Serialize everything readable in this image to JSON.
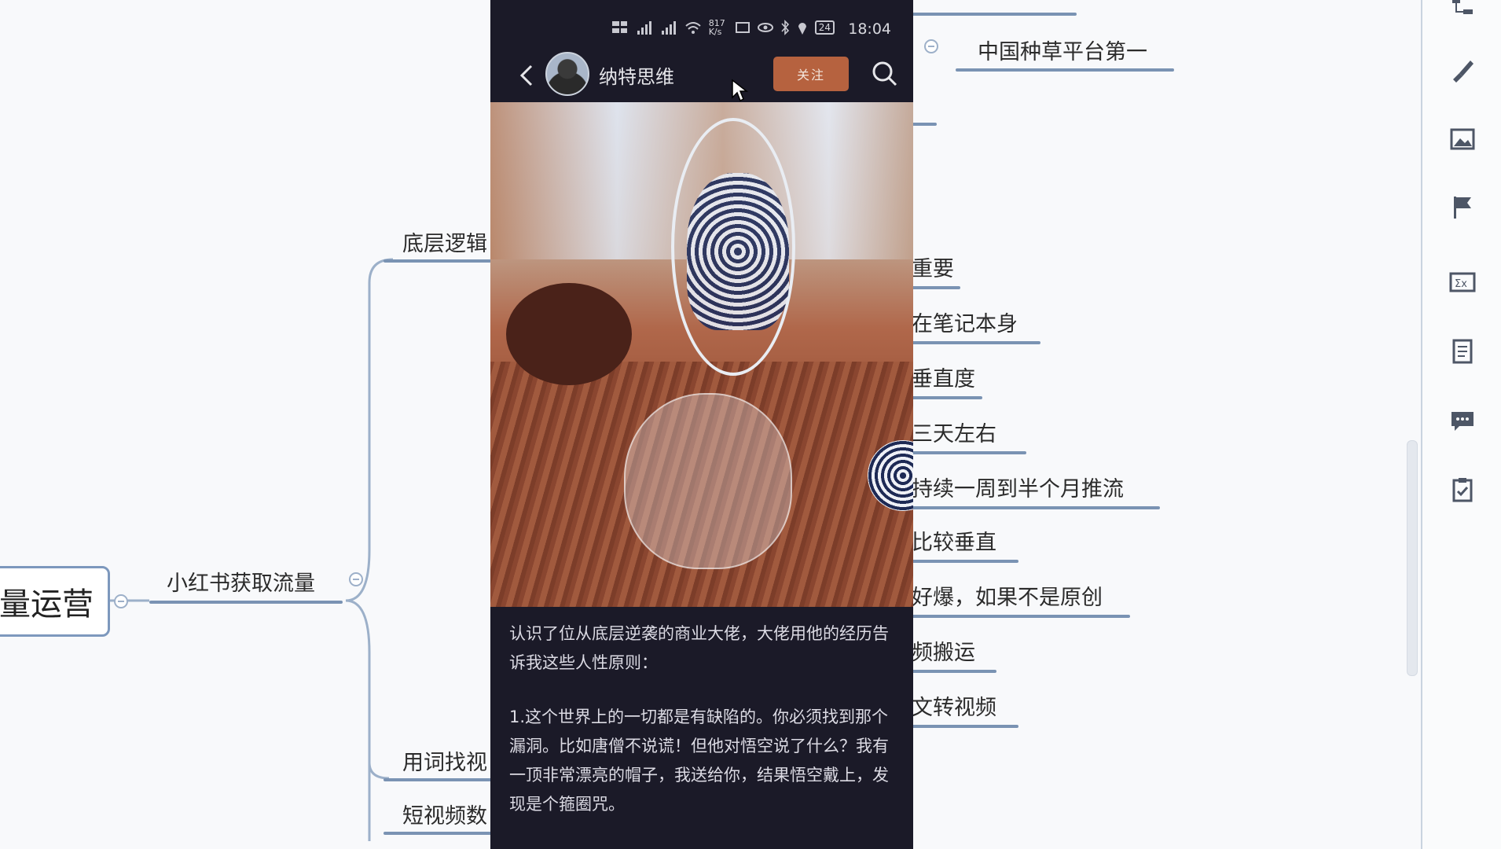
{
  "mindmap": {
    "root": "量运营",
    "branch": "小红书获取流量",
    "children_left": [
      "底层逻辑",
      "用词找视",
      "短视频数"
    ],
    "children_right": [
      "中国种草平台第一",
      "重要",
      "在笔记本身",
      "垂直度",
      "三天左右",
      "持续一周到半个月推流",
      "比较垂直",
      "好爆，如果不是原创",
      "频搬运",
      "文转视频"
    ]
  },
  "phone": {
    "status": {
      "net_speed": "817 K/s",
      "battery": "24",
      "time": "18:04"
    },
    "header": {
      "author": "纳特思维",
      "follow_label": "关注"
    },
    "caption": {
      "para1": "认识了位从底层逆袭的商业大佬，大佬用他的经历告诉我这些人性原则：",
      "para2": "1.这个世界上的一切都是有缺陷的。你必须找到那个漏洞。比如唐僧不说谎！但他对悟空说了什么？我有一顶非常漂亮的帽子，我送给你，结果悟空戴上，发现是个箍圈咒。"
    }
  },
  "toolbar": {
    "icons": [
      "structure-icon",
      "brush-icon",
      "image-icon",
      "flag-icon",
      "formula-icon",
      "note-icon",
      "comment-icon",
      "task-icon"
    ]
  },
  "colors": {
    "phone_bg": "#1b1a28",
    "follow_button": "#b6623f",
    "mindmap_line": "#7a93b3"
  }
}
